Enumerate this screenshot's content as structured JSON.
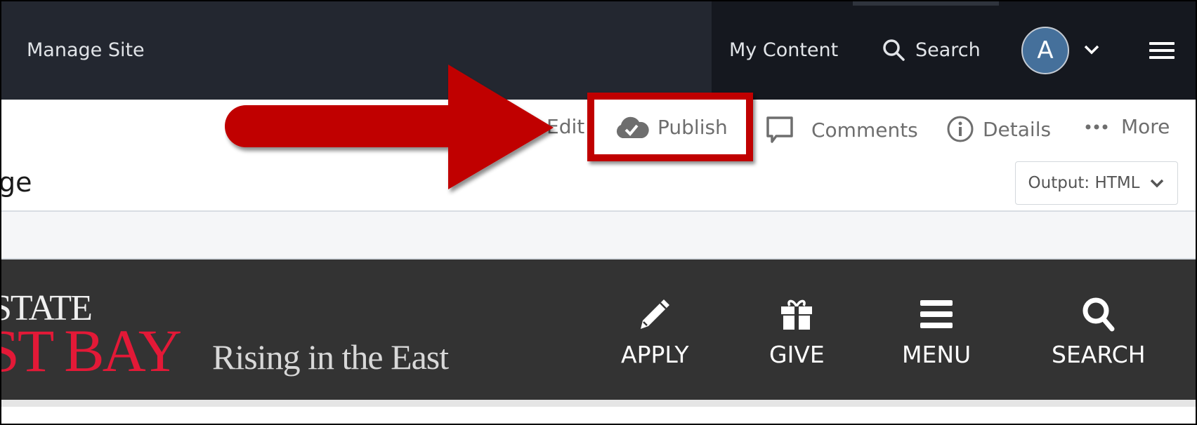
{
  "header": {
    "manage_site": "Manage Site",
    "my_content": "My Content",
    "search_label": "Search",
    "avatar_initial": "A"
  },
  "toolbar": {
    "edit": "Edit",
    "publish": "Publish",
    "comments": "Comments",
    "details": "Details",
    "more": "More"
  },
  "page": {
    "title_fragment": "ge",
    "output_select": "Output: HTML"
  },
  "site_preview": {
    "logo_line1": "STATE",
    "logo_line2": "ST BAY",
    "tagline": "Rising in the East",
    "nav": [
      {
        "label": "APPLY",
        "icon": "pencil-icon"
      },
      {
        "label": "GIVE",
        "icon": "gift-icon"
      },
      {
        "label": "MENU",
        "icon": "menu-icon"
      },
      {
        "label": "SEARCH",
        "icon": "search-icon"
      }
    ]
  },
  "annotation": {
    "color": "#c00000",
    "target": "Publish"
  }
}
